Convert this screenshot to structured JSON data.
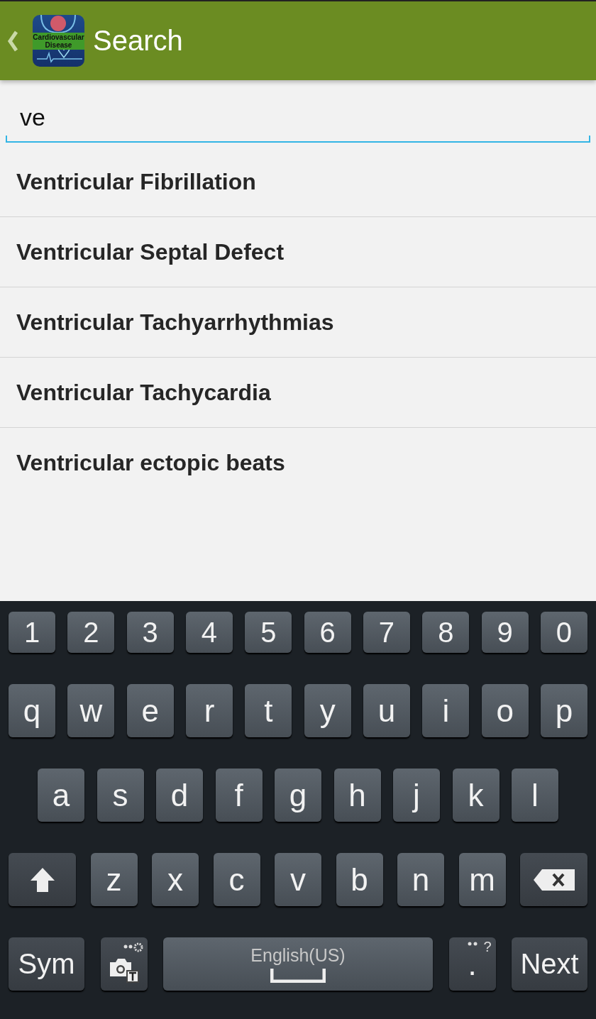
{
  "header": {
    "title": "Search",
    "app_icon": {
      "label": "Cardiovascular Disease"
    }
  },
  "search": {
    "value": "ve"
  },
  "results": [
    {
      "label": "Ventricular Fibrillation"
    },
    {
      "label": "Ventricular Septal Defect"
    },
    {
      "label": "Ventricular Tachyarrhythmias"
    },
    {
      "label": "Ventricular Tachycardia"
    },
    {
      "label": "Ventricular ectopic beats"
    }
  ],
  "keyboard": {
    "number_row": [
      {
        "kind": "char",
        "label": "1"
      },
      {
        "kind": "char",
        "label": "2"
      },
      {
        "kind": "char",
        "label": "3"
      },
      {
        "kind": "char",
        "label": "4"
      },
      {
        "kind": "char",
        "label": "5"
      },
      {
        "kind": "char",
        "label": "6"
      },
      {
        "kind": "char",
        "label": "7"
      },
      {
        "kind": "char",
        "label": "8"
      },
      {
        "kind": "char",
        "label": "9"
      },
      {
        "kind": "char",
        "label": "0"
      }
    ],
    "top_row": [
      {
        "kind": "char",
        "label": "q"
      },
      {
        "kind": "char",
        "label": "w"
      },
      {
        "kind": "char",
        "label": "e"
      },
      {
        "kind": "char",
        "label": "r"
      },
      {
        "kind": "char",
        "label": "t"
      },
      {
        "kind": "char",
        "label": "y"
      },
      {
        "kind": "char",
        "label": "u"
      },
      {
        "kind": "char",
        "label": "i"
      },
      {
        "kind": "char",
        "label": "o"
      },
      {
        "kind": "char",
        "label": "p"
      }
    ],
    "home_row": [
      {
        "kind": "char",
        "label": "a"
      },
      {
        "kind": "char",
        "label": "s"
      },
      {
        "kind": "char",
        "label": "d"
      },
      {
        "kind": "char",
        "label": "f"
      },
      {
        "kind": "char",
        "label": "g"
      },
      {
        "kind": "char",
        "label": "h"
      },
      {
        "kind": "char",
        "label": "j"
      },
      {
        "kind": "char",
        "label": "k"
      },
      {
        "kind": "char",
        "label": "l"
      }
    ],
    "lower_row": [
      {
        "kind": "shift"
      },
      {
        "kind": "char",
        "label": "z"
      },
      {
        "kind": "char",
        "label": "x"
      },
      {
        "kind": "char",
        "label": "c"
      },
      {
        "kind": "char",
        "label": "v"
      },
      {
        "kind": "char",
        "label": "b"
      },
      {
        "kind": "char",
        "label": "n"
      },
      {
        "kind": "char",
        "label": "m"
      },
      {
        "kind": "backspace"
      }
    ],
    "function_row": [
      {
        "kind": "wide",
        "label": "Sym"
      },
      {
        "kind": "tools"
      },
      {
        "kind": "space",
        "label": "English(US)"
      },
      {
        "kind": "period",
        "label": ".",
        "hint": "?"
      },
      {
        "kind": "wide",
        "label": "Next"
      }
    ]
  }
}
